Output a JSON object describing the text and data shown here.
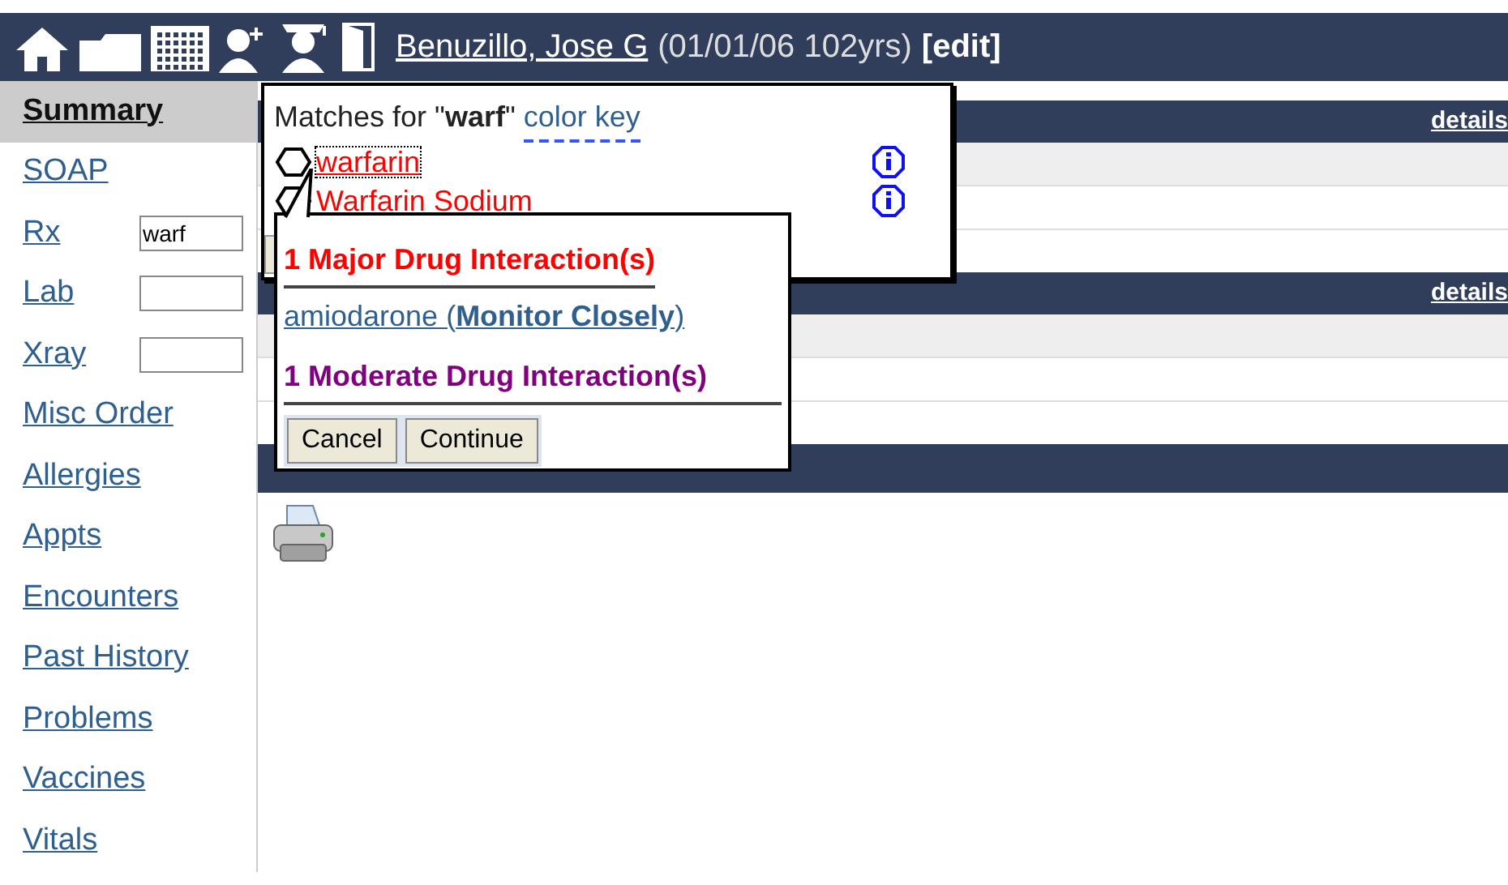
{
  "header": {
    "patient_name": "Benuzillo, Jose G",
    "patient_info": "(01/01/06 102yrs)",
    "edit": "[edit]"
  },
  "sidebar": {
    "items": [
      {
        "label": "Summary",
        "selected": true,
        "kind": "link"
      },
      {
        "label": "SOAP",
        "selected": false,
        "kind": "link"
      },
      {
        "label": "Rx",
        "selected": false,
        "kind": "field",
        "value": "warf"
      },
      {
        "label": "Lab",
        "selected": false,
        "kind": "field"
      },
      {
        "label": "Xray",
        "selected": false,
        "kind": "field"
      },
      {
        "label": "Misc Order",
        "selected": false,
        "kind": "link"
      },
      {
        "label": "Allergies",
        "selected": false,
        "kind": "link"
      },
      {
        "label": "Appts",
        "selected": false,
        "kind": "link"
      },
      {
        "label": "Encounters",
        "selected": false,
        "kind": "link"
      },
      {
        "label": "Past History",
        "selected": false,
        "kind": "link"
      },
      {
        "label": "Problems",
        "selected": false,
        "kind": "link"
      },
      {
        "label": "Vaccines",
        "selected": false,
        "kind": "link"
      },
      {
        "label": "Vitals",
        "selected": false,
        "kind": "link"
      }
    ]
  },
  "sections": [
    {
      "link": "details"
    },
    {
      "link": "details"
    }
  ],
  "matches_popup": {
    "label": "Matches for \"**warf**\"",
    "color_key": "color key",
    "matches": [
      {
        "name": "warfarin",
        "focused": true,
        "color": "#ff0000"
      },
      {
        "name": "Warfarin Sodium",
        "focused": false,
        "color": "#ff0000"
      }
    ]
  },
  "interaction_popup": {
    "major": "1 Major Drug Interaction(s)",
    "drug": "amiodarone (**Monitor Closely**)",
    "moderate": "1 Moderate Drug Interaction(s)",
    "buttons": [
      "Cancel",
      "Continue"
    ]
  }
}
